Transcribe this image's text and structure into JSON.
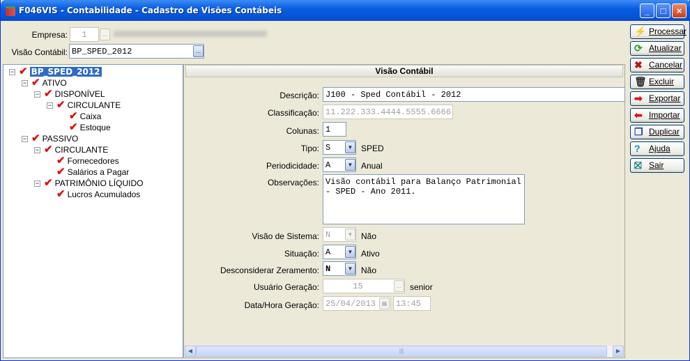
{
  "window": {
    "title": "F046VIS - Contabilidade - Cadastro de Visões Contábeis",
    "min": "_",
    "max": "□",
    "close": "×"
  },
  "top": {
    "empresa_label": "Empresa:",
    "empresa_value": "1",
    "visao_label": "Visão Contábil:",
    "visao_value": "BP_SPED_2012",
    "ellipsis": "..."
  },
  "tree": [
    {
      "label": "BP_SPED_2012",
      "level": 0,
      "expander": true,
      "selected": true
    },
    {
      "label": "ATIVO",
      "level": 1,
      "expander": true
    },
    {
      "label": "DISPONÍVEL",
      "level": 2,
      "expander": true
    },
    {
      "label": "CIRCULANTE",
      "level": 3,
      "expander": true
    },
    {
      "label": "Caixa",
      "level": 4,
      "expander": false
    },
    {
      "label": "Estoque",
      "level": 4,
      "expander": false
    },
    {
      "label": "PASSIVO",
      "level": 1,
      "expander": true
    },
    {
      "label": "CIRCULANTE",
      "level": 2,
      "expander": true
    },
    {
      "label": "Fornecedores",
      "level": 3,
      "expander": false
    },
    {
      "label": "Salários a Pagar",
      "level": 3,
      "expander": false
    },
    {
      "label": "PATRIMÔNIO LÍQUIDO",
      "level": 2,
      "expander": true
    },
    {
      "label": "Lucros Acumulados",
      "level": 3,
      "expander": false
    }
  ],
  "panel": {
    "title": "Visão Contábil"
  },
  "form": {
    "descricao_label": "Descrição:",
    "descricao": "J100 - Sped Contábil - 2012",
    "classificacao_label": "Classificação:",
    "classificacao": "11.222.333.4444.5555.6666",
    "colunas_label": "Colunas:",
    "colunas": "1",
    "tipo_label": "Tipo:",
    "tipo": "S",
    "tipo_desc": "SPED",
    "periodicidade_label": "Periodicidade:",
    "periodicidade": "A",
    "periodicidade_desc": "Anual",
    "observacoes_label": "Observações:",
    "observacoes_1": "Visão contábil para Balanço Patrimonial",
    "observacoes_2": "- SPED - Ano 2011.",
    "visao_sistema_label": "Visão de Sistema:",
    "visao_sistema": "N",
    "visao_sistema_desc": "Não",
    "situacao_label": "Situação:",
    "situacao": "A",
    "situacao_desc": "Ativo",
    "desconsiderar_label": "Desconsiderar Zeramento:",
    "desconsiderar": "N",
    "desconsiderar_desc": "Não",
    "usuario_label": "Usuário Geração:",
    "usuario": "15",
    "usuario_desc": "senior",
    "data_label": "Data/Hora Geração:",
    "data": "25/04/2013",
    "hora": "13:45"
  },
  "buttons": [
    {
      "label": "Processar",
      "icon": "lightning-icon",
      "glyph": "⚡",
      "color": "#e0c000"
    },
    {
      "label": "Atualizar",
      "icon": "refresh-icon",
      "glyph": "⟳",
      "color": "#20a020"
    },
    {
      "label": "Cancelar",
      "icon": "x-icon",
      "glyph": "✖",
      "color": "#c01010"
    },
    {
      "label": "Excluir",
      "icon": "trash-icon",
      "glyph": "🗑",
      "color": "#333333"
    },
    {
      "label": "Exportar",
      "icon": "export-icon",
      "glyph": "➡",
      "color": "#e01010"
    },
    {
      "label": "Importar",
      "icon": "import-icon",
      "glyph": "⬅",
      "color": "#e01010"
    },
    {
      "label": "Duplicar",
      "icon": "duplicate-icon",
      "glyph": "❐",
      "color": "#2040a0"
    },
    {
      "label": "Ajuda",
      "icon": "help-icon",
      "glyph": "?",
      "color": "#1090c0"
    },
    {
      "label": "Sair",
      "icon": "exit-icon",
      "glyph": "⛝",
      "color": "#108080"
    }
  ]
}
